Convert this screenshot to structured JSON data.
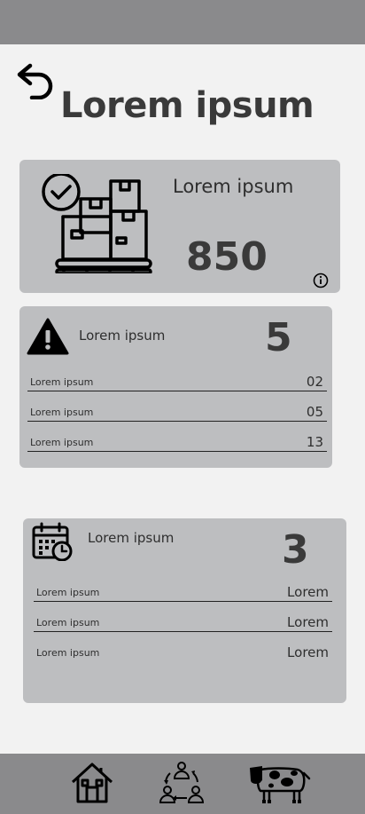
{
  "header": {
    "title": "Lorem ipsum"
  },
  "summary_card": {
    "label": "Lorem ipsum",
    "value": "850"
  },
  "alerts_card": {
    "label": "Lorem ipsum",
    "count": "5",
    "rows": [
      {
        "label": "Lorem ipsum",
        "value": "02"
      },
      {
        "label": "Lorem ipsum",
        "value": "05"
      },
      {
        "label": "Lorem ipsum",
        "value": "13"
      }
    ]
  },
  "schedule_card": {
    "label": "Lorem ipsum",
    "count": "3",
    "rows": [
      {
        "label": "Lorem ipsum",
        "value": "Lorem"
      },
      {
        "label": "Lorem ipsum",
        "value": "Lorem"
      },
      {
        "label": "Lorem ipsum",
        "value": "Lorem"
      }
    ]
  },
  "bottom_nav": {
    "items": [
      {
        "icon": "home-icon"
      },
      {
        "icon": "people-cycle-icon"
      },
      {
        "icon": "cow-icon"
      }
    ]
  },
  "colors": {
    "bars": "#8a8a8c",
    "cards": "#bdbec0",
    "background": "#f2f2f2"
  }
}
